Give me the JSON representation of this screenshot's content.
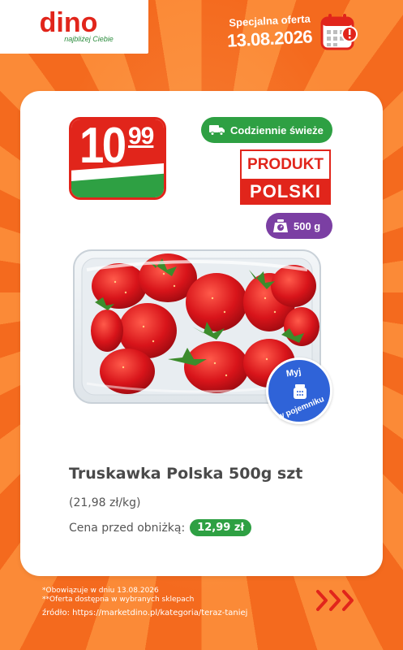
{
  "header": {
    "logo_word": "dino",
    "logo_tagline": "najbliżej Ciebie",
    "offer_label": "Specjalna oferta",
    "offer_date": "13.08.2026"
  },
  "product": {
    "price_int": "10",
    "price_dec": "99",
    "fresh_badge": "Codziennie świeże",
    "polish_top": "PRODUKT",
    "polish_bottom": "POLSKI",
    "weight": "500 g",
    "wash_line1": "Myj",
    "wash_line2": "w pojemniku",
    "name": "Truskawka Polska 500g szt",
    "unit_price": "(21,98 zł/kg)",
    "prev_label": "Cena przed obniżką:",
    "prev_price": "12,99 zł"
  },
  "footer": {
    "note1": "*Obowiązuje w dniu 13.08.2026",
    "note2": "**Oferta dostępna w wybranych sklepach",
    "source": "źródło: https://marketdino.pl/kategoria/teraz-taniej"
  },
  "colors": {
    "brand_red": "#e1251b",
    "brand_green": "#2ea043",
    "background_orange": "#f7661c",
    "weight_purple": "#7b3fa3",
    "wash_blue": "#2f63d8"
  },
  "icons": [
    "truck-icon",
    "scale-icon",
    "calendar-alert-icon",
    "container-icon",
    "chevrons-right-icon"
  ]
}
